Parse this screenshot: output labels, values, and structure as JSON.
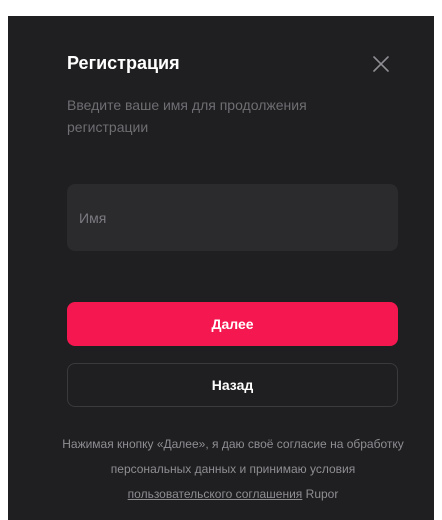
{
  "modal": {
    "title": "Регистрация",
    "subtitle": "Введите ваше имя для продолжения регистрации",
    "close_icon": "close-icon",
    "name_field": {
      "placeholder": "Имя",
      "value": ""
    },
    "next_label": "Далее",
    "back_label": "Назад",
    "consent": {
      "text_before": "Нажимая кнопку «Далее», я даю своё согласие на обработку персональных данных и принимаю условия ",
      "link_text": "пользовательского соглашения",
      "text_after": " Rupor"
    }
  },
  "colors": {
    "modal_background": "#1f1f21",
    "field_background": "#2b2b2e",
    "accent": "#f5174f",
    "muted_text": "#8e8e93"
  }
}
